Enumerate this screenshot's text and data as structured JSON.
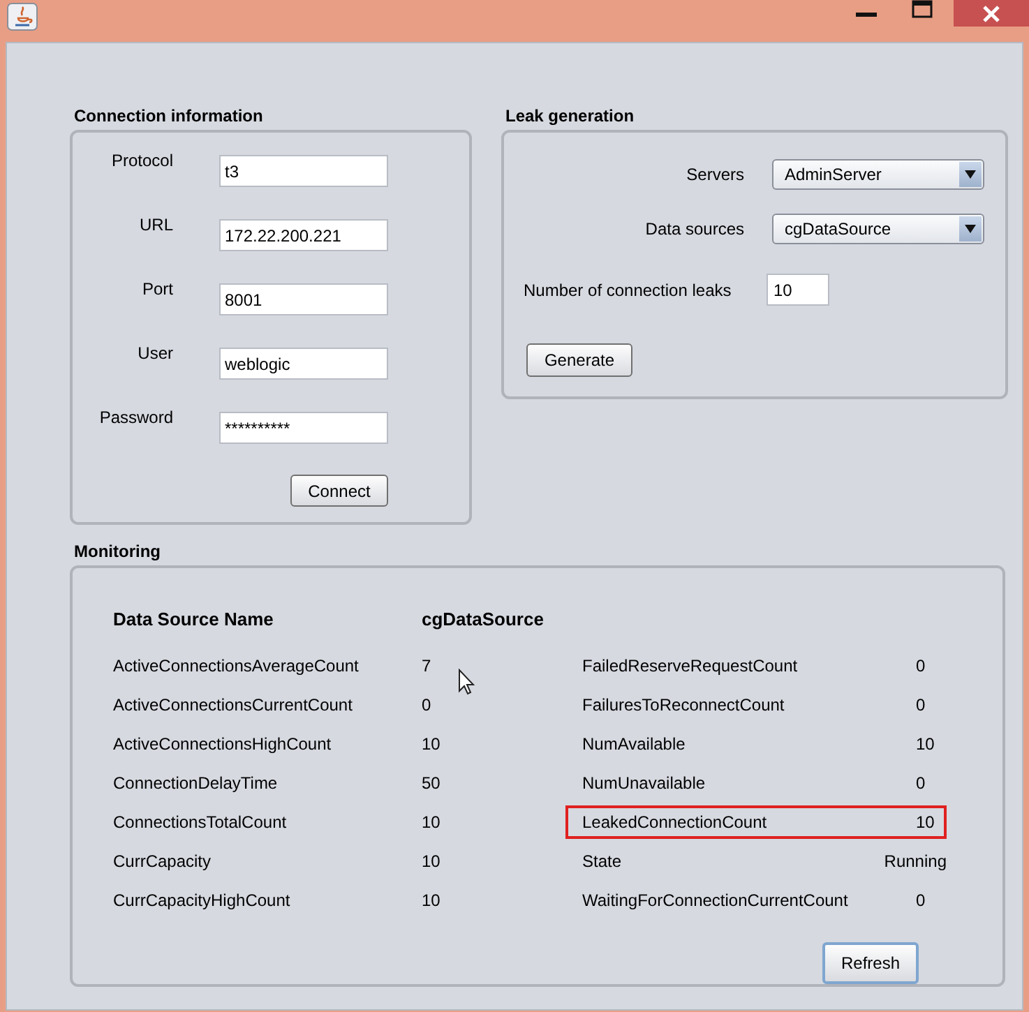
{
  "connection": {
    "title": "Connection information",
    "fields": [
      {
        "label": "Protocol",
        "value": "t3"
      },
      {
        "label": "URL",
        "value": "172.22.200.221"
      },
      {
        "label": "Port",
        "value": "8001"
      },
      {
        "label": "User",
        "value": "weblogic"
      },
      {
        "label": "Password",
        "value": "**********"
      }
    ],
    "button": "Connect"
  },
  "leak": {
    "title": "Leak generation",
    "servers": {
      "label": "Servers",
      "value": "AdminServer"
    },
    "data_sources": {
      "label": "Data sources",
      "value": "cgDataSource"
    },
    "leaks": {
      "label": "Number of connection leaks",
      "value": "10"
    },
    "button": "Generate"
  },
  "monitoring": {
    "title": "Monitoring",
    "header": {
      "name": "Data Source Name",
      "value": "cgDataSource"
    },
    "left_column": [
      {
        "name": "ActiveConnectionsAverageCount",
        "value": "7"
      },
      {
        "name": "ActiveConnectionsCurrentCount",
        "value": "0"
      },
      {
        "name": "ActiveConnectionsHighCount",
        "value": "10"
      },
      {
        "name": "ConnectionDelayTime",
        "value": "50"
      },
      {
        "name": "ConnectionsTotalCount",
        "value": "10"
      },
      {
        "name": "CurrCapacity",
        "value": "10"
      },
      {
        "name": "CurrCapacityHighCount",
        "value": "10"
      }
    ],
    "right_column": [
      {
        "name": "FailedReserveRequestCount",
        "value": "0",
        "highlighted": false
      },
      {
        "name": "FailuresToReconnectCount",
        "value": "0",
        "highlighted": false
      },
      {
        "name": "NumAvailable",
        "value": "10",
        "highlighted": false
      },
      {
        "name": "NumUnavailable",
        "value": "0",
        "highlighted": false
      },
      {
        "name": "LeakedConnectionCount",
        "value": "10",
        "highlighted": true
      },
      {
        "name": "State",
        "value": "Running",
        "highlighted": false
      },
      {
        "name": "WaitingForConnectionCurrentCount",
        "value": "0",
        "highlighted": false
      }
    ],
    "button": "Refresh"
  }
}
